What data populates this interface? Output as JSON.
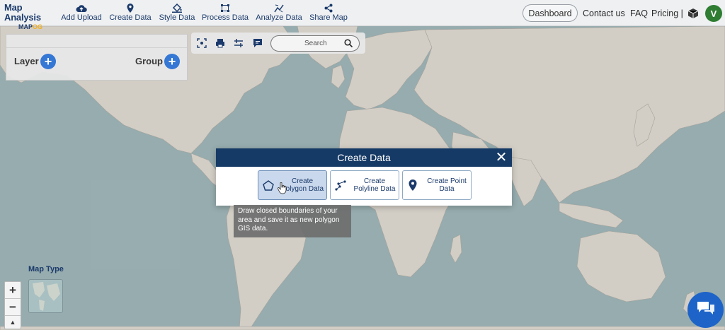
{
  "logo": {
    "line1": "Map Analysis",
    "line2_a": "MAP",
    "line2_b": "OG"
  },
  "nav": [
    {
      "label": "Add Upload",
      "icon": "cloud-upload-icon"
    },
    {
      "label": "Create Data",
      "icon": "map-pin-icon"
    },
    {
      "label": "Style Data",
      "icon": "paint-bucket-icon"
    },
    {
      "label": "Process Data",
      "icon": "process-icon"
    },
    {
      "label": "Analyze Data",
      "icon": "analyze-icon"
    },
    {
      "label": "Share Map",
      "icon": "share-icon"
    }
  ],
  "right_nav": {
    "dashboard": "Dashboard",
    "contact": "Contact us",
    "faq": "FAQ",
    "pricing": "Pricing |",
    "avatar_letter": "V"
  },
  "panel": {
    "layer": "Layer",
    "group": "Group"
  },
  "toolbar": {
    "search_placeholder": "Search"
  },
  "modal": {
    "title": "Create Data",
    "options": [
      {
        "line1": "Create",
        "line2": "Polygon Data",
        "icon": "polygon-icon",
        "active": true
      },
      {
        "line1": "Create",
        "line2": "Polyline Data",
        "icon": "polyline-icon",
        "active": false
      },
      {
        "line1": "Create Point",
        "line2": "Data",
        "icon": "point-pin-icon",
        "active": false
      }
    ],
    "tooltip": "Draw closed boundaries of your area and save it as new polygon GIS data."
  },
  "map_type": {
    "label": "Map Type"
  },
  "zoom": {
    "in": "+",
    "out": "−",
    "north": "▲"
  },
  "colors": {
    "brand": "#1b3a6b",
    "accent": "#3577d4",
    "modal_header": "#163a66",
    "avatar": "#2e7d32"
  }
}
